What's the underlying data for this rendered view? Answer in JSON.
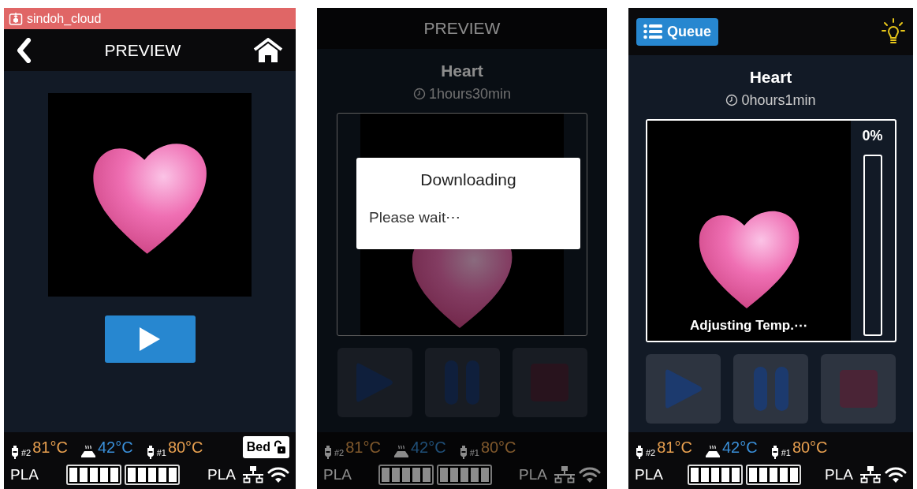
{
  "screens": [
    {
      "kind": "preview",
      "dimmed": false,
      "app_bar": {
        "title": "sindoh_cloud"
      },
      "header": {
        "kind": "nav",
        "title": "PREVIEW"
      },
      "status_bar": {
        "temps": [
          {
            "kind": "nozzle",
            "label": "#2",
            "value": "81°C"
          },
          {
            "kind": "bed",
            "value": "42°C"
          },
          {
            "kind": "nozzle",
            "label": "#1",
            "value": "80°C"
          }
        ],
        "bed_button": {
          "label": "Bed",
          "locked": false
        },
        "materials": [
          "PLA",
          "PLA"
        ],
        "gauges": [
          {
            "level": 1
          },
          {
            "level": 1
          }
        ]
      }
    },
    {
      "kind": "job",
      "dimmed": true,
      "header": {
        "kind": "title",
        "title": "PREVIEW"
      },
      "job": {
        "name": "Heart",
        "time": "1hours30min"
      },
      "controls": [
        {
          "kind": "play",
          "disabled": true
        },
        {
          "kind": "pause",
          "disabled": true
        },
        {
          "kind": "stop",
          "disabled": true
        }
      ],
      "dialog": {
        "title": "Downloading",
        "message": "Please wait⋯"
      },
      "status_bar": {
        "temps": [
          {
            "kind": "nozzle",
            "label": "#2",
            "value": "81°C"
          },
          {
            "kind": "bed",
            "value": "42°C"
          },
          {
            "kind": "nozzle",
            "label": "#1",
            "value": "80°C"
          }
        ],
        "materials": [
          "PLA",
          "PLA"
        ],
        "gauges": [
          {
            "level": 1
          },
          {
            "level": 1
          }
        ]
      }
    },
    {
      "kind": "job",
      "dimmed": false,
      "header": {
        "kind": "queue",
        "button": "Queue"
      },
      "job": {
        "name": "Heart",
        "time": "0hours1min",
        "status": "Adjusting Temp.⋯",
        "progress": "0%",
        "level": 0
      },
      "controls": [
        {
          "kind": "play",
          "disabled": true
        },
        {
          "kind": "pause",
          "disabled": true
        },
        {
          "kind": "stop",
          "disabled": true
        }
      ],
      "status_bar": {
        "temps": [
          {
            "kind": "nozzle",
            "label": "#2",
            "value": "81°C"
          },
          {
            "kind": "bed",
            "value": "42°C"
          },
          {
            "kind": "nozzle",
            "label": "#1",
            "value": "80°C"
          }
        ],
        "materials": [
          "PLA",
          "PLA"
        ],
        "gauges": [
          {
            "level": 1
          },
          {
            "level": 1
          }
        ]
      }
    }
  ]
}
